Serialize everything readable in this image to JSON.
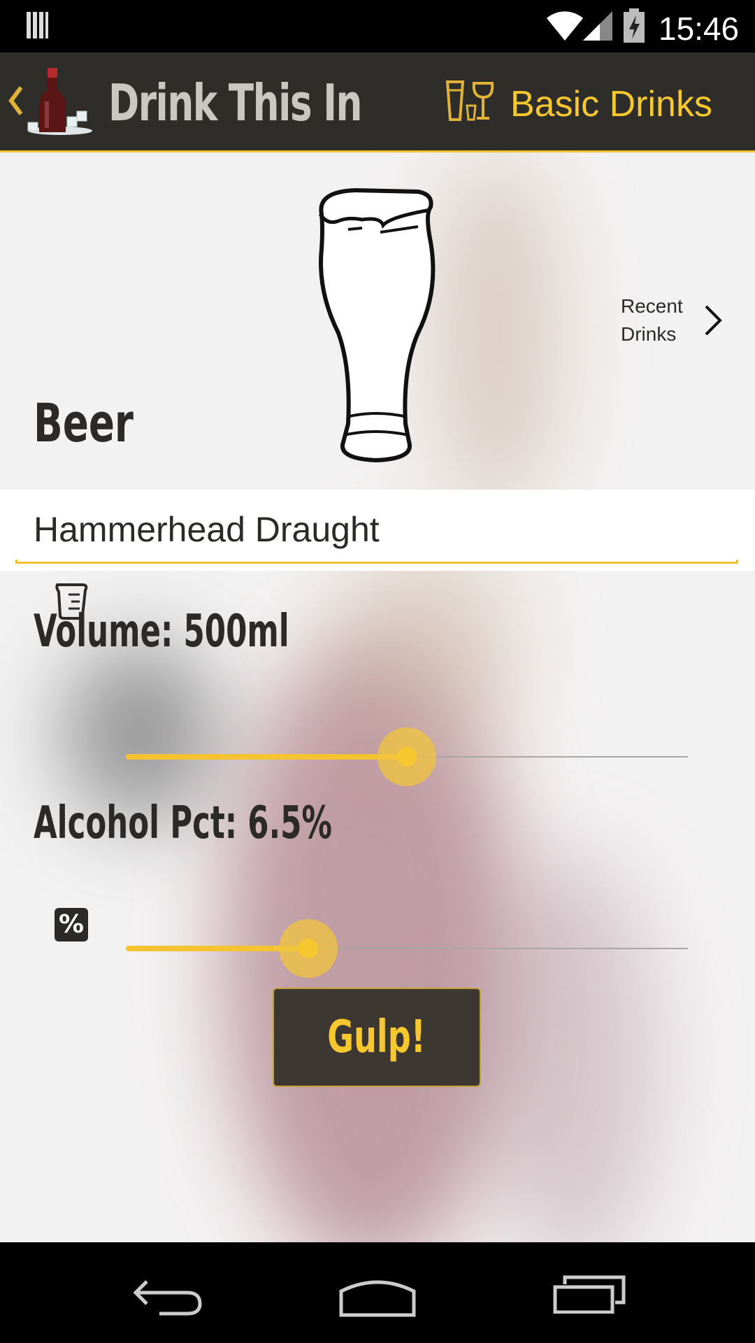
{
  "status_bar": {
    "time": "15:46",
    "icons": [
      "notification-icon",
      "wifi-icon",
      "signal-icon",
      "battery-charging-icon"
    ]
  },
  "action_bar": {
    "app_title": "Drink This In",
    "category_label": "Basic Drinks",
    "icons": [
      "back-chevron-icon",
      "beer-bottle-logo-icon",
      "glasses-icon"
    ]
  },
  "drink": {
    "type": "Beer",
    "name": "Hammerhead Draught",
    "recent_label": "Recent Drinks"
  },
  "volume": {
    "label": "Volume: 500ml",
    "level": 0.5
  },
  "alcohol": {
    "label": "Alcohol Pct: 6.5%",
    "level": 0.325,
    "icon_text": "%"
  },
  "actions": {
    "gulp_label": "Gulp!"
  },
  "colors": {
    "accent": "#f7c72e",
    "action_bar_bg": "#2f2d29",
    "button_bg": "#3d3732",
    "text_dark": "#2b2a28"
  },
  "nav_bar": {
    "icons": [
      "back-icon",
      "home-icon",
      "recents-icon"
    ]
  }
}
